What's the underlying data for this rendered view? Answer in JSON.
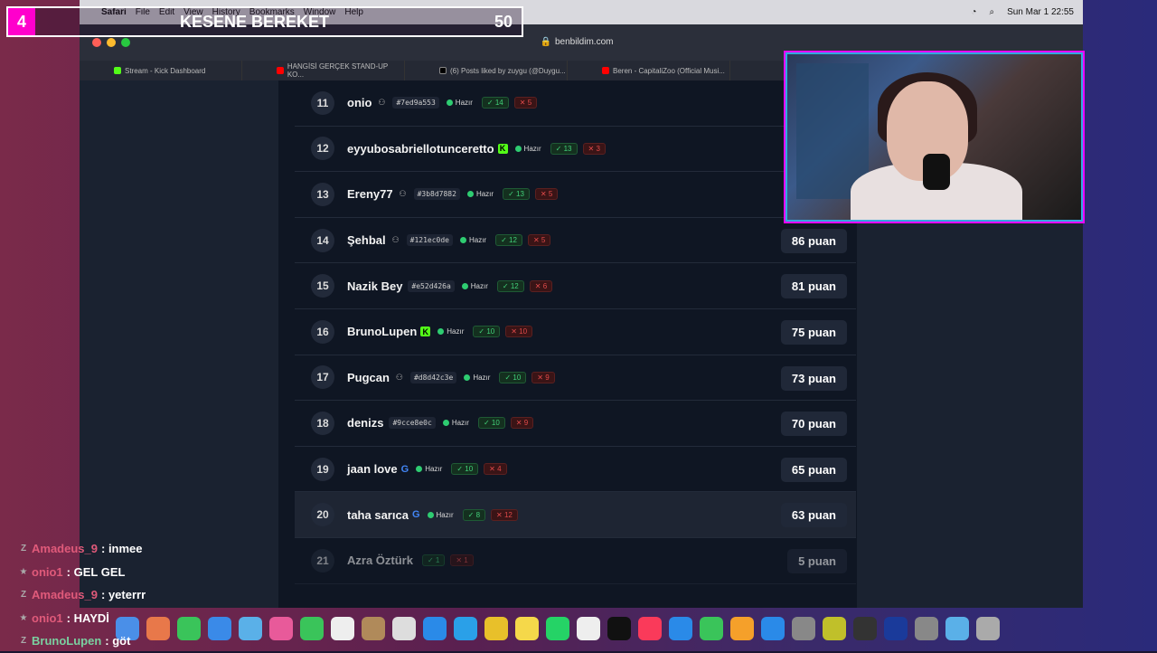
{
  "menubar": {
    "app": "Safari",
    "items": [
      "File",
      "Edit",
      "View",
      "History",
      "Bookmarks",
      "Window",
      "Help"
    ],
    "clock": "Sun Mar 1  22:55"
  },
  "browser": {
    "url": "benbildim.com",
    "tabs": [
      {
        "label": "Stream - Kick Dashboard",
        "color": "#53fc18"
      },
      {
        "label": "HANGİSİ GERÇEK STAND-UP KO...",
        "color": "#ff0000"
      },
      {
        "label": "(6) Posts liked by zuygu (@Duygu...",
        "color": "#000000"
      },
      {
        "label": "Beren - CapitaliZoo (Official Musi...",
        "color": "#ff0000"
      }
    ]
  },
  "overlay": {
    "round": "4",
    "title": "KESENE BEREKET",
    "score": "50"
  },
  "status_ready": "Hazır",
  "rows": [
    {
      "rank": "11",
      "name": "onio",
      "icon": "user",
      "hash": "#7ed9a553",
      "ok": "14",
      "bad": "5",
      "score": ""
    },
    {
      "rank": "12",
      "name": "eyyubosabriellotunceretto",
      "icon": "kick",
      "hash": "",
      "ok": "13",
      "bad": "3",
      "score": ""
    },
    {
      "rank": "13",
      "name": "Ereny77",
      "icon": "user",
      "hash": "#3b8d7882",
      "ok": "13",
      "bad": "5",
      "score": ""
    },
    {
      "rank": "14",
      "name": "Şehbal",
      "icon": "user",
      "hash": "#121ec0de",
      "ok": "12",
      "bad": "5",
      "score": "86 puan"
    },
    {
      "rank": "15",
      "name": "Nazik Bey",
      "icon": "",
      "hash": "#e52d426a",
      "ok": "12",
      "bad": "6",
      "score": "81 puan"
    },
    {
      "rank": "16",
      "name": "BrunoLupen",
      "icon": "kick",
      "hash": "",
      "ok": "10",
      "bad": "10",
      "score": "75 puan"
    },
    {
      "rank": "17",
      "name": "Pugcan",
      "icon": "user",
      "hash": "#d8d42c3e",
      "ok": "10",
      "bad": "9",
      "score": "73 puan"
    },
    {
      "rank": "18",
      "name": "denizs",
      "icon": "",
      "hash": "#9cce8e0c",
      "ok": "10",
      "bad": "9",
      "score": "70 puan"
    },
    {
      "rank": "19",
      "name": "jaan love",
      "icon": "google",
      "hash": "",
      "ok": "10",
      "bad": "4",
      "score": "65 puan"
    },
    {
      "rank": "20",
      "name": "taha sarıca",
      "icon": "google",
      "hash": "",
      "ok": "8",
      "bad": "12",
      "score": "63 puan"
    },
    {
      "rank": "21",
      "name": "Azra Öztürk",
      "icon": "",
      "hash": "",
      "ok": "1",
      "bad": "1",
      "score": "5 puan",
      "dim": true
    }
  ],
  "chat": [
    {
      "user": "Amadeus_9",
      "color": "#e05a7a",
      "badges": "Z",
      "msg": "inmee"
    },
    {
      "user": "onio1",
      "color": "#e05a7a",
      "badges": "★",
      "msg": "GEL GEL"
    },
    {
      "user": "Amadeus_9",
      "color": "#e05a7a",
      "badges": "Z",
      "msg": "yeterrr"
    },
    {
      "user": "onio1",
      "color": "#e05a7a",
      "badges": "★",
      "msg": "HAYDİ"
    },
    {
      "user": "BrunoLupen",
      "color": "#7ad0a0",
      "badges": "Z",
      "msg": "göt"
    }
  ],
  "colors": {
    "accent": "#3b45d8",
    "kick": "#53fc18",
    "ok": "#42d17a",
    "bad": "#e04a4a",
    "overlay": "#ff00cc"
  }
}
